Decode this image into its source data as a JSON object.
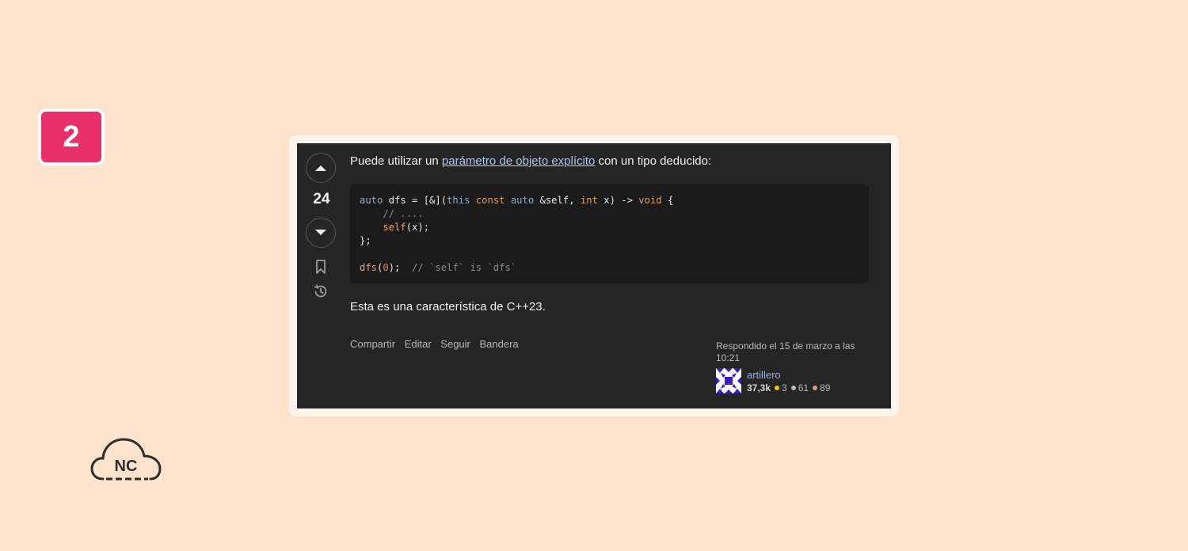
{
  "step_badge": "2",
  "post": {
    "vote_count": "24",
    "intro_prefix": "Puede utilizar un ",
    "intro_link": "parámetro de objeto explícito",
    "intro_suffix": " con un tipo deducido:",
    "code": {
      "l1_auto": "auto",
      "l1_a": " dfs = [&](",
      "l1_this": "this",
      "l1_const": "const",
      "l1_auto2": "auto",
      "l1_b": " &self, ",
      "l1_int": "int",
      "l1_c": " x) -> ",
      "l1_void": "void",
      "l1_d": " {",
      "l2_comment": "// ....",
      "l3_self": "self",
      "l3_rest": "(x);",
      "l4": "};",
      "l6_dfs": "dfs",
      "l6_open": "(",
      "l6_zero": "0",
      "l6_close": ");",
      "l6_comment": "// `self` is `dfs`"
    },
    "note": "Esta es una característica de C++23.",
    "actions": [
      "Compartir",
      "Editar",
      "Seguir",
      "Bandera"
    ],
    "answered_text": "Respondido el 15 de marzo a las 10:21",
    "user": {
      "name": "artillero",
      "reputation": "37,3k",
      "gold": "3",
      "silver": "61",
      "bronze": "89"
    }
  },
  "logo_text": "NC",
  "colors": {
    "page_background": "#fee3cc",
    "badge": "#e8316a",
    "card": "#252525",
    "link": "#a9c9f5"
  }
}
